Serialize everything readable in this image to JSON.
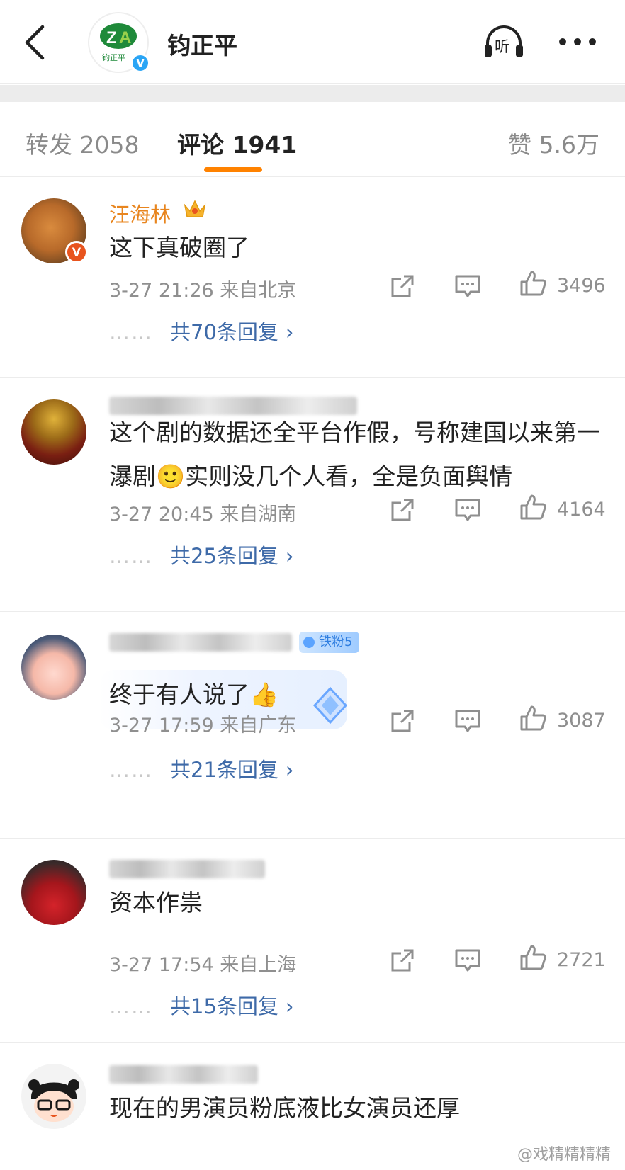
{
  "header": {
    "account_name": "钧正平",
    "avatar_text": "钧正平",
    "verified_mark": "V",
    "listen_label": "听"
  },
  "tabs": {
    "reposts": "转发 2058",
    "comments": "评论 1941",
    "likes": "赞 5.6万"
  },
  "comments": [
    {
      "username": "汪海林",
      "text": "这下真破圈了",
      "time_location": "3-27 21:26  来自北京",
      "likes": "3496",
      "replies": "共70条回复"
    },
    {
      "username": "",
      "text": "这个剧的数据还全平台作假，号称建国以来第一瀑剧🙂实则没几个人看，全是负面舆情",
      "time_location": "3-27 20:45  来自湖南",
      "likes": "4164",
      "replies": "共25条回复"
    },
    {
      "username": "",
      "fan_badge": "铁粉5",
      "text": "终于有人说了👍",
      "time_location": "3-27 17:59  来自广东",
      "likes": "3087",
      "replies": "共21条回复"
    },
    {
      "username": "",
      "text": "资本作祟",
      "time_location": "3-27 17:54  来自上海",
      "likes": "2721",
      "replies": "共15条回复"
    },
    {
      "username": "",
      "text": "现在的男演员粉底液比女演员还厚"
    }
  ],
  "reply_dots": "……",
  "chevron": "›",
  "watermark": "@戏精精精精",
  "colors": {
    "accent": "#ff8200",
    "username_vip": "#e8851e",
    "link": "#3e6aa8",
    "meta": "#8f8f8f"
  },
  "icons": [
    "back-arrow-icon",
    "headphones-icon",
    "more-dots-icon",
    "share-icon",
    "comment-icon",
    "thumbs-up-icon",
    "crown-icon",
    "diamond-icon"
  ]
}
